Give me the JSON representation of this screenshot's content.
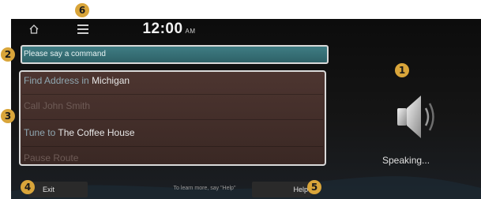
{
  "header": {
    "time": "12:00",
    "ampm": "AM"
  },
  "prompt": {
    "text": "Please say a command"
  },
  "commands": [
    {
      "keyword": "Find Address in",
      "value": "Michigan"
    },
    {
      "keyword": "Call John Smith",
      "value": ""
    },
    {
      "keyword": "Tune to",
      "value": "The Coffee House"
    },
    {
      "keyword": "Pause Route",
      "value": ""
    }
  ],
  "footer": {
    "exit_label": "Exit",
    "hint": "To learn more, say \"Help\"",
    "help_label": "Help"
  },
  "status": {
    "speaking": "Speaking..."
  },
  "callouts": [
    "1",
    "2",
    "3",
    "4",
    "5",
    "6"
  ],
  "icons": [
    "home-icon",
    "menu-icon",
    "speaker-icon"
  ],
  "colors": {
    "callout": "#d9a53a",
    "prompt_bar": "#3f7c83",
    "command_list": "#4d3530"
  }
}
